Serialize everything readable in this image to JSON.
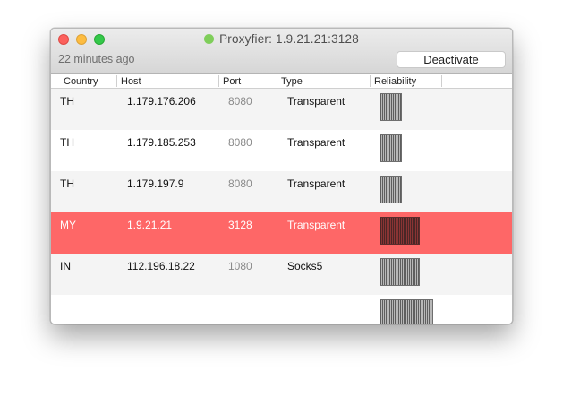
{
  "window": {
    "title": "Proxyfier: 1.9.21.21:3128",
    "status_color": "#7fce5a",
    "updated_text": "22 minutes ago",
    "deactivate_label": "Deactivate"
  },
  "table": {
    "headers": {
      "country": "Country",
      "host": "Host",
      "port": "Port",
      "type": "Type",
      "reliability": "Reliability"
    },
    "rows": [
      {
        "country": "TH",
        "host": "1.179.176.206",
        "port": "8080",
        "type": "Transparent",
        "reliability": 0.25
      },
      {
        "country": "TH",
        "host": "1.179.185.253",
        "port": "8080",
        "type": "Transparent",
        "reliability": 0.25
      },
      {
        "country": "TH",
        "host": "1.179.197.9",
        "port": "8080",
        "type": "Transparent",
        "reliability": 0.25
      },
      {
        "country": "MY",
        "host": "1.9.21.21",
        "port": "3128",
        "type": "Transparent",
        "reliability": 0.45,
        "selected": true
      },
      {
        "country": "IN",
        "host": "112.196.18.22",
        "port": "1080",
        "type": "Socks5",
        "reliability": 0.45
      }
    ]
  },
  "colors": {
    "selection": "#fe6767",
    "row_alt": "#f4f4f4"
  }
}
